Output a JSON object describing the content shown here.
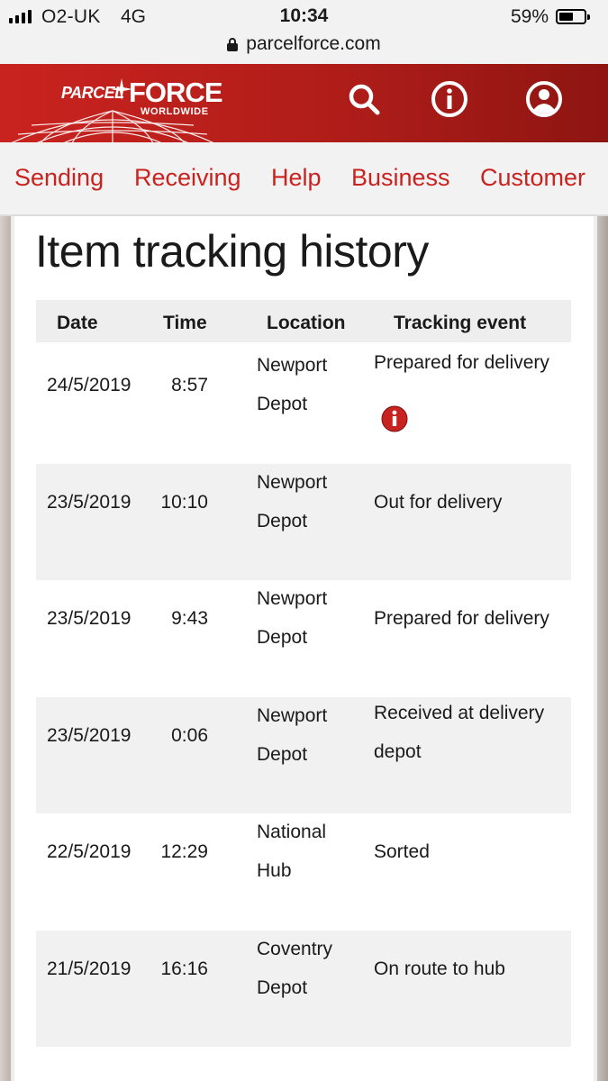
{
  "status_bar": {
    "carrier": "O2-UK",
    "network": "4G",
    "time": "10:34",
    "battery_percent": "59%",
    "battery_level": 0.59
  },
  "browser": {
    "url": "parcelforce.com"
  },
  "header": {
    "logo": {
      "parcel": "PARCEL",
      "force": "FORCE",
      "worldwide": "WORLDWIDE"
    },
    "icons": [
      "search-icon",
      "info-icon",
      "account-icon"
    ],
    "brand_color": "#c9231f"
  },
  "nav": {
    "items": [
      {
        "label": "Sending"
      },
      {
        "label": "Receiving"
      },
      {
        "label": "Help"
      },
      {
        "label": "Business"
      },
      {
        "label": "Customer"
      }
    ]
  },
  "main": {
    "title": "Item tracking history",
    "table": {
      "columns": [
        "Date",
        "Time",
        "Location",
        "Tracking event"
      ],
      "rows": [
        {
          "date": "24/5/2019",
          "time": "8:57",
          "loc1": "Newport",
          "loc2": "Depot",
          "ev1": "Prepared for delivery",
          "ev2": "",
          "info": true
        },
        {
          "date": "23/5/2019",
          "time": "10:10",
          "loc1": "Newport",
          "loc2": "Depot",
          "ev1": "Out for delivery",
          "ev2": ""
        },
        {
          "date": "23/5/2019",
          "time": "9:43",
          "loc1": "Newport",
          "loc2": "Depot",
          "ev1": "Prepared for delivery",
          "ev2": ""
        },
        {
          "date": "23/5/2019",
          "time": "0:06",
          "loc1": "Newport",
          "loc2": "Depot",
          "ev1": "Received at delivery",
          "ev2": "depot"
        },
        {
          "date": "22/5/2019",
          "time": "12:29",
          "loc1": "National",
          "loc2": "Hub",
          "ev1": "Sorted",
          "ev2": ""
        },
        {
          "date": "21/5/2019",
          "time": "16:16",
          "loc1": "Coventry",
          "loc2": "Depot",
          "ev1": "On route to hub",
          "ev2": ""
        }
      ]
    },
    "info_badge_color": "#c9231f"
  }
}
